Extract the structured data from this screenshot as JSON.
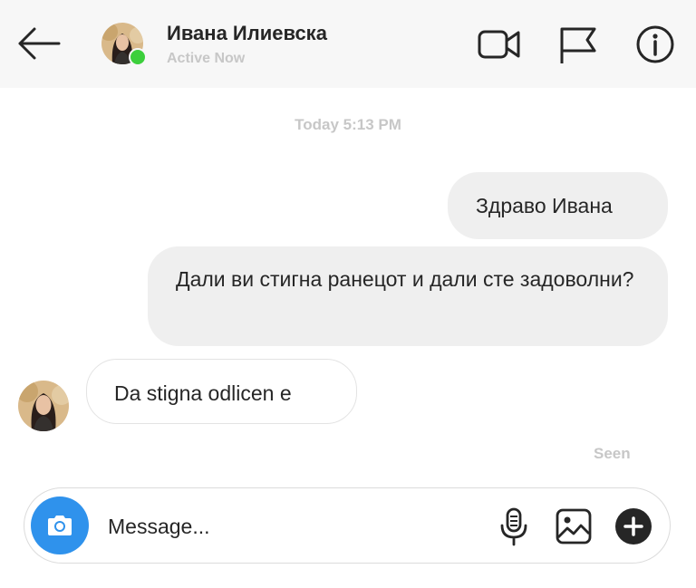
{
  "header": {
    "contact_name": "Ивана Илиевска",
    "status": "Active Now",
    "icons": [
      "back-arrow-icon",
      "video-call-icon",
      "flag-icon",
      "info-icon"
    ]
  },
  "conversation": {
    "timestamp": "Today 5:13 PM",
    "messages": [
      {
        "direction": "sent",
        "text": "Здраво Ивана"
      },
      {
        "direction": "sent",
        "text": "Дали ви стигна ранецот и дали сте задоволни?"
      },
      {
        "direction": "received",
        "text": "Da stigna odlicen e"
      }
    ],
    "seen_label": "Seen"
  },
  "composer": {
    "placeholder": "Message...",
    "icons": [
      "camera-icon",
      "microphone-icon",
      "image-icon",
      "plus-icon"
    ]
  },
  "colors": {
    "header_bg": "#f7f7f7",
    "bubble_sent": "#efefef",
    "camera_button": "#2f92ec",
    "online_dot": "#3ccf3c",
    "muted_text": "#c7c7c7"
  }
}
